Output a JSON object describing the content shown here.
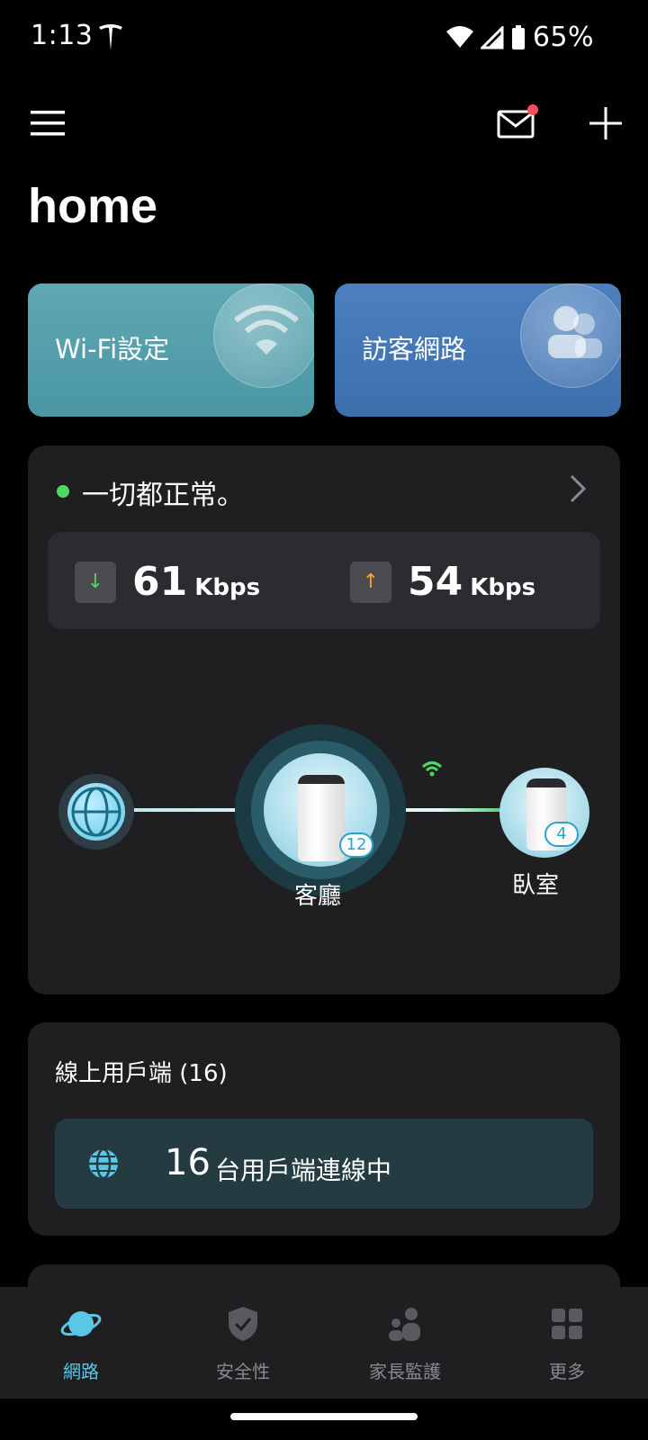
{
  "status_bar": {
    "time": "1:13",
    "battery": "65%"
  },
  "header": {
    "title": "home"
  },
  "quick_cards": {
    "wifi_label": "Wi-Fi設定",
    "guest_label": "訪客網路"
  },
  "network": {
    "status_text": "一切都正常。",
    "download": {
      "value": "61",
      "unit": "Kbps"
    },
    "upload": {
      "value": "54",
      "unit": "Kbps"
    },
    "main_node": {
      "label": "客廳",
      "clients": "12"
    },
    "satellite_node": {
      "label": "臥室",
      "clients": "4"
    }
  },
  "clients": {
    "title": "線上用戶端 (16)",
    "count": "16",
    "text": "台用戶端連線中"
  },
  "bottom_nav": {
    "items": [
      {
        "label": "網路",
        "icon": "planet-icon"
      },
      {
        "label": "安全性",
        "icon": "shield-icon"
      },
      {
        "label": "家長監護",
        "icon": "family-icon"
      },
      {
        "label": "更多",
        "icon": "grid-icon"
      }
    ],
    "active_color": "#5cc6e6"
  }
}
